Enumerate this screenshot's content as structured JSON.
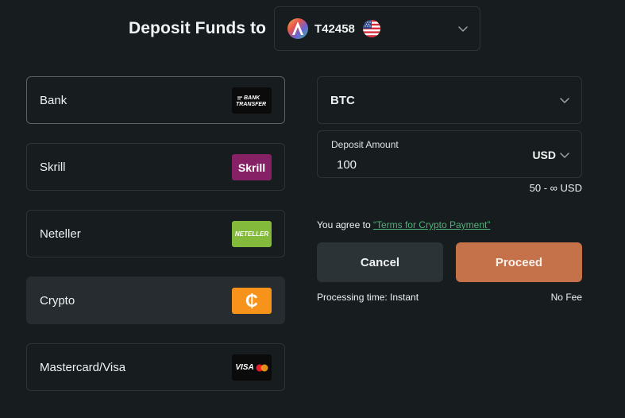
{
  "header": {
    "title": "Deposit Funds to",
    "account": {
      "name": "T42458",
      "logo_icon": "account-logo-icon",
      "flag_icon": "us-flag-icon"
    }
  },
  "methods": [
    {
      "label": "Bank",
      "badge": [
        "BANK",
        "TRANSFER"
      ],
      "icon": "bank-transfer-icon"
    },
    {
      "label": "Skrill",
      "badge": "Skrill",
      "icon": "skrill-icon"
    },
    {
      "label": "Neteller",
      "badge": "NETELLER",
      "icon": "neteller-icon"
    },
    {
      "label": "Crypto",
      "badge": "₵",
      "icon": "crypto-icon"
    },
    {
      "label": "Mastercard/Visa",
      "badge": "VISA",
      "icon": "visa-mastercard-icon"
    }
  ],
  "form": {
    "currency": "BTC",
    "amount_label": "Deposit Amount",
    "amount_value": "100",
    "unit": "USD",
    "range": "50 - ∞ USD",
    "agree_prefix": "You agree to",
    "agree_link": "“Terms for Crypto Payment”",
    "cancel_label": "Cancel",
    "proceed_label": "Proceed",
    "processing": "Processing time: Instant",
    "fee": "No Fee"
  },
  "colors": {
    "background": "#171c1e",
    "accent": "#c5714a",
    "link": "#4fb27a",
    "skrill": "#862165",
    "neteller": "#83ba3b",
    "crypto": "#f7931a"
  }
}
